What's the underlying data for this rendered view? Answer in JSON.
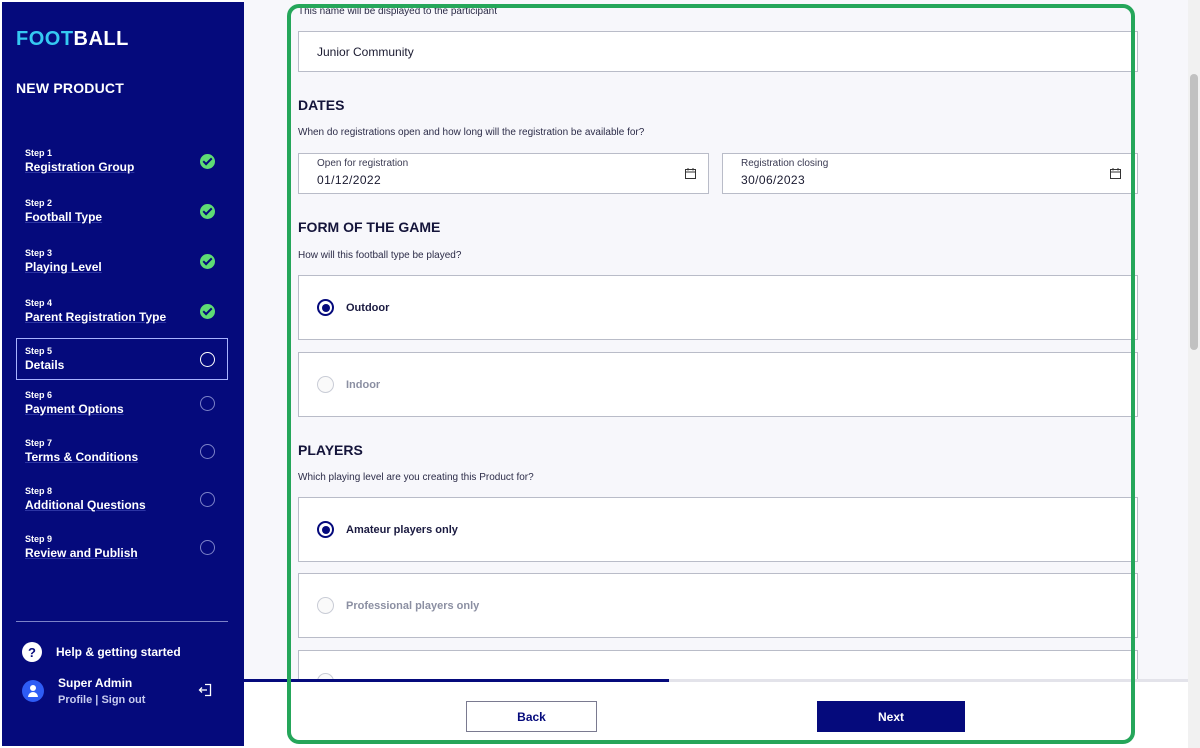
{
  "brand": {
    "logo_part1": "FOOT",
    "logo_part2": "BALL",
    "accent": "#35c9f2",
    "primary": "#050a7c",
    "success": "#5edb74"
  },
  "sidebar": {
    "title": "NEW PRODUCT",
    "steps": [
      {
        "number": "Step 1",
        "label": "Registration Group",
        "status": "done"
      },
      {
        "number": "Step 2",
        "label": "Football Type",
        "status": "done"
      },
      {
        "number": "Step 3",
        "label": "Playing Level",
        "status": "done"
      },
      {
        "number": "Step 4",
        "label": "Parent Registration Type",
        "status": "done"
      },
      {
        "number": "Step 5",
        "label": "Details",
        "status": "current"
      },
      {
        "number": "Step 6",
        "label": "Payment Options",
        "status": "pending"
      },
      {
        "number": "Step 7",
        "label": "Terms & Conditions",
        "status": "pending"
      },
      {
        "number": "Step 8",
        "label": "Additional Questions",
        "status": "pending"
      },
      {
        "number": "Step 9",
        "label": "Review and Publish",
        "status": "pending"
      }
    ],
    "help_label": "Help & getting started",
    "user_name": "Super Admin",
    "profile_link": "Profile",
    "link_separator": "|",
    "signout_link": "Sign out"
  },
  "form": {
    "name_hint": "This name will be displayed to the participant",
    "name_value": "Junior Community",
    "dates": {
      "heading": "DATES",
      "hint": "When do registrations open and how long will the registration be available for?",
      "open_label": "Open for registration",
      "open_value": "01/12/2022",
      "close_label": "Registration closing",
      "close_value": "30/06/2023"
    },
    "form_of_game": {
      "heading": "FORM OF THE GAME",
      "hint": "How will this football type be played?",
      "options": [
        {
          "label": "Outdoor",
          "selected": true
        },
        {
          "label": "Indoor",
          "selected": false
        }
      ]
    },
    "players": {
      "heading": "PLAYERS",
      "hint": "Which playing level are you creating this Product for?",
      "options": [
        {
          "label": "Amateur players only",
          "selected": true
        },
        {
          "label": "Professional players only",
          "selected": false
        }
      ]
    }
  },
  "progress": {
    "percent": 45
  },
  "footer": {
    "back_label": "Back",
    "next_label": "Next"
  }
}
